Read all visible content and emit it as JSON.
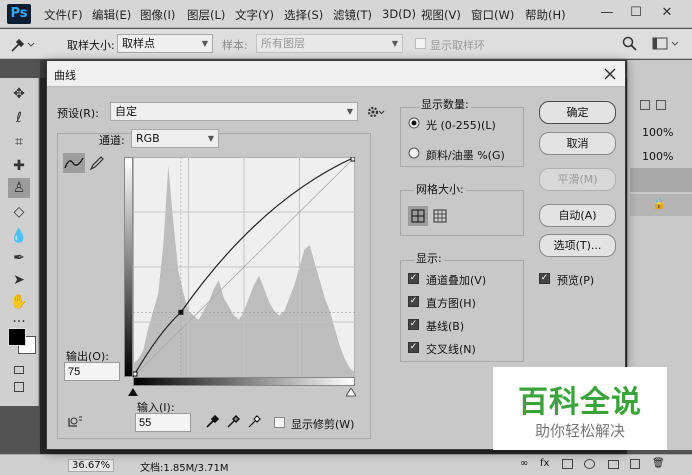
{
  "app": {
    "logo": "Ps"
  },
  "menu": [
    "文件(F)",
    "编辑(E)",
    "图像(I)",
    "图层(L)",
    "文字(Y)",
    "选择(S)",
    "滤镜(T)",
    "3D(D)",
    "视图(V)",
    "窗口(W)",
    "帮助(H)"
  ],
  "window_controls": {
    "minimize": "—",
    "restore": "☐",
    "close": "✕"
  },
  "options_bar": {
    "sample_size_label": "取样大小:",
    "sample_size_value": "取样点",
    "sample_label": "样本:",
    "sample_value": "所有图层",
    "show_ring_label": "显示取样环"
  },
  "right_panel": {
    "opacity_1": "100%",
    "opacity_2": "100%"
  },
  "status": {
    "zoom": "36.67%",
    "doc": "文档:1.85M/3.71M"
  },
  "dialog": {
    "title": "曲线",
    "preset_label": "预设(R):",
    "preset_value": "自定",
    "channel_label": "通道:",
    "channel_value": "RGB",
    "output_label": "输出(O):",
    "output_value": "75",
    "input_label": "输入(I):",
    "input_value": "55",
    "show_clipping_label": "显示修剪(W)",
    "show_amount": {
      "title": "显示数量:",
      "light": "光 (0-255)(L)",
      "pigment": "颜料/油墨 %(G)",
      "selected": "light"
    },
    "grid_size": {
      "title": "网格大小:"
    },
    "display": {
      "title": "显示:",
      "channel_overlays": "通道叠加(V)",
      "histogram": "直方图(H)",
      "baseline": "基线(B)",
      "intersection_line": "交叉线(N)"
    },
    "buttons": {
      "ok": "确定",
      "cancel": "取消",
      "smooth": "平滑(M)",
      "auto": "自动(A)",
      "options": "选项(T)..."
    },
    "preview_label": "预览(P)"
  },
  "curve": {
    "point": {
      "input": 55,
      "output": 75
    },
    "histogram_profile": [
      6,
      8,
      12,
      22,
      30,
      38,
      60,
      96,
      70,
      48,
      38,
      30,
      28,
      26,
      30,
      34,
      40,
      44,
      36,
      32,
      28,
      26,
      30,
      36,
      42,
      46,
      40,
      34,
      30,
      28,
      30,
      36,
      42,
      50,
      58,
      60,
      52,
      44,
      36,
      30,
      22,
      14,
      8,
      4,
      2
    ]
  },
  "watermark": {
    "title": "百科全说",
    "subtitle": "助你轻松解决",
    "colors": {
      "green": "#3aa43a",
      "gray": "#777777"
    }
  }
}
